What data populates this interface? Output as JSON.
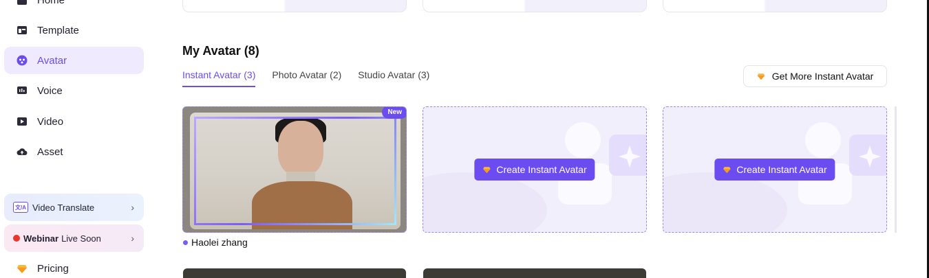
{
  "sidebar": {
    "items": [
      {
        "label": "Home",
        "icon": "home-icon"
      },
      {
        "label": "Template",
        "icon": "template-icon"
      },
      {
        "label": "Avatar",
        "icon": "avatar-icon",
        "active": true
      },
      {
        "label": "Voice",
        "icon": "voice-icon"
      },
      {
        "label": "Video",
        "icon": "video-icon"
      },
      {
        "label": "Asset",
        "icon": "cloud-upload-icon"
      }
    ],
    "promos": {
      "translate": {
        "label": "Video Translate",
        "icon_text": "文/A"
      },
      "webinar": {
        "bold": "Webinar",
        "label": "Live Soon"
      }
    },
    "pricing": {
      "label": "Pricing",
      "icon": "gem-icon"
    }
  },
  "main": {
    "section_title": "My Avatar (8)",
    "tabs": [
      {
        "label": "Instant Avatar (3)",
        "active": true
      },
      {
        "label": "Photo Avatar (2)"
      },
      {
        "label": "Studio Avatar (3)"
      }
    ],
    "get_more_label": "Get More Instant Avatar",
    "cards": {
      "first": {
        "badge": "New",
        "name": "Haolei zhang"
      },
      "create_label": "Create Instant Avatar"
    }
  },
  "colors": {
    "accent": "#6a4cf0",
    "active_bg": "#efeafd",
    "card_bg": "#f2effc"
  }
}
